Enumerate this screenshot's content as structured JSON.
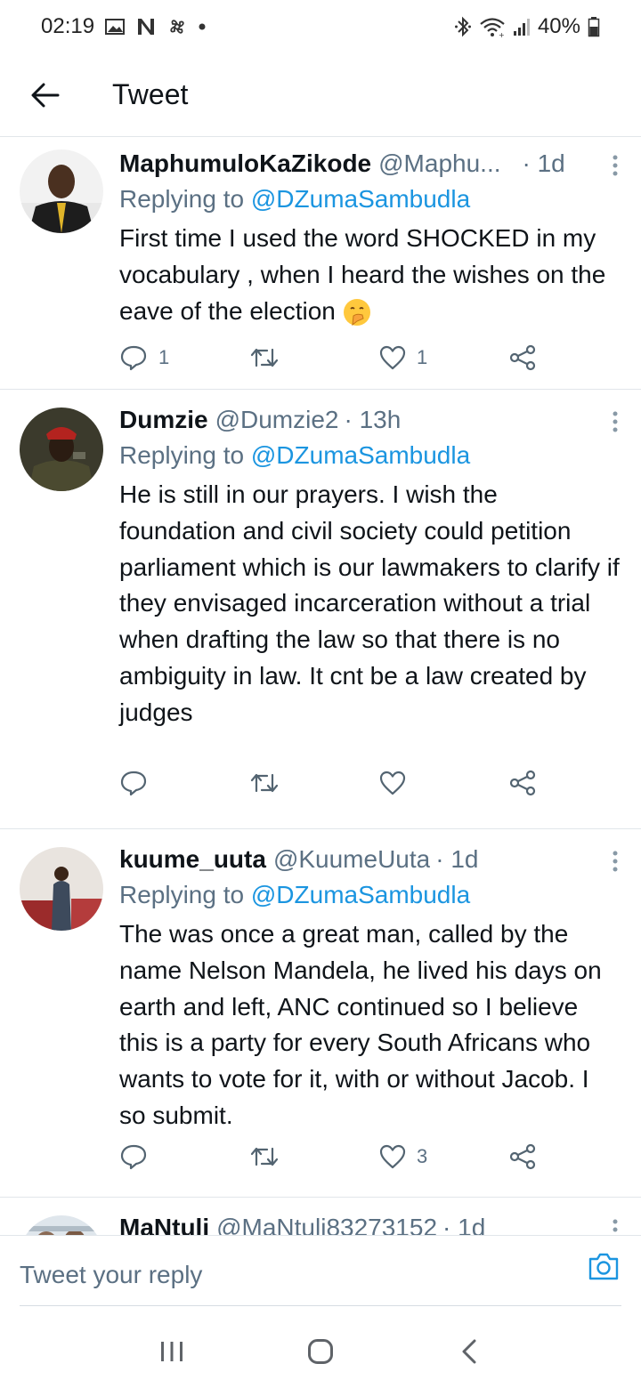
{
  "status_bar": {
    "time": "02:19",
    "battery": "40%",
    "icons_left": [
      "image-icon",
      "n-icon",
      "fan-icon",
      "dot-icon"
    ],
    "icons_right": [
      "bluetooth-icon",
      "wifi-icon",
      "signal-icon",
      "battery-icon"
    ]
  },
  "header": {
    "title": "Tweet"
  },
  "tweets": [
    {
      "name": "MaphumuloKaZikode",
      "handle": "@Maphu...",
      "time": "· 1d",
      "reply_prefix": "Replying to",
      "reply_to": "@DZumaSambudla",
      "text": "First time I used the word SHOCKED in my vocabulary , when I heard the wishes on the eave of the election",
      "emoji": "face-with-hand-over-mouth",
      "replies": "1",
      "retweets": "",
      "likes": "1"
    },
    {
      "name": "Dumzie",
      "handle": "@Dumzie2",
      "time": "· 13h",
      "reply_prefix": "Replying to",
      "reply_to": "@DZumaSambudla",
      "text": "He is still in our prayers. I wish the foundation and civil society could petition parliament which is our lawmakers to clarify if they envisaged incarceration without a trial when drafting the law so that there is no ambiguity in law. It cnt be a law created by judges",
      "replies": "",
      "retweets": "",
      "likes": ""
    },
    {
      "name": "kuume_uuta",
      "handle": "@KuumeUuta",
      "time": "· 1d",
      "reply_prefix": "Replying to",
      "reply_to": "@DZumaSambudla",
      "text": "The was once a great man, called by the name Nelson Mandela, he lived his days on earth and left, ANC continued so I believe this is a party for every South Africans who wants to vote for it, with or without Jacob. I so submit.",
      "replies": "",
      "retweets": "",
      "likes": "3"
    },
    {
      "name": "MaNtuli",
      "handle": "@MaNtuli83273152",
      "time": "· 1d"
    }
  ],
  "reply_bar": {
    "placeholder": "Tweet your reply"
  },
  "colors": {
    "link": "#1b95e0",
    "secondary_text": "#5b7083",
    "primary_text": "#0f1419",
    "divider": "#e1e6ea"
  }
}
